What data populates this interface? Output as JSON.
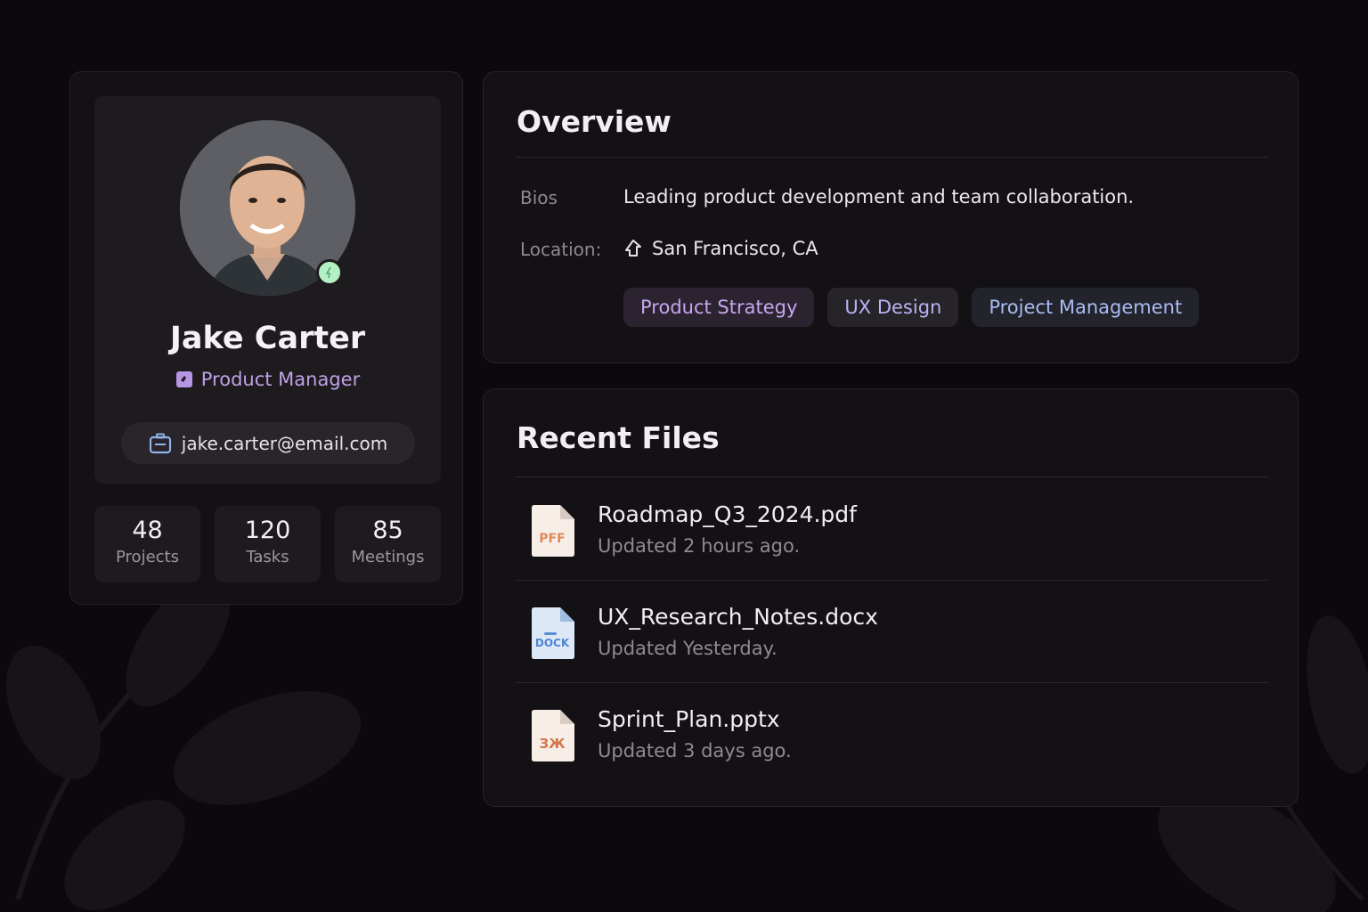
{
  "profile": {
    "name": "Jake Carter",
    "role": "Product Manager",
    "email": "jake.carter@email.com",
    "online_status": "online",
    "stats": [
      {
        "value": "48",
        "label": "Projects"
      },
      {
        "value": "120",
        "label": "Tasks"
      },
      {
        "value": "85",
        "label": "Meetings"
      }
    ]
  },
  "overview": {
    "title": "Overview",
    "bios_label": "Bios",
    "bios_value": "Leading product development and team collaboration.",
    "location_label": "Location:",
    "location_value": "San Francisco, CA",
    "tags": [
      "Product Strategy",
      "UX Design",
      "Project Management"
    ]
  },
  "recent_files": {
    "title": "Recent Files",
    "files": [
      {
        "name": "Roadmap_Q3_2024.pdf",
        "updated": "Updated 2 hours ago.",
        "icon": "pdf-file-icon",
        "badge": "PFF"
      },
      {
        "name": "UX_Research_Notes.docx",
        "updated": "Updated Yesterday.",
        "icon": "docx-file-icon",
        "badge": "DOCK"
      },
      {
        "name": "Sprint_Plan.pptx",
        "updated": "Updated  3 days ago.",
        "icon": "pptx-file-icon",
        "badge": "ЗЖ"
      }
    ]
  },
  "colors": {
    "background": "#0b090c",
    "card": "#141115",
    "accent_purple": "#bfa1e6",
    "status_green": "#b3f0c3"
  }
}
